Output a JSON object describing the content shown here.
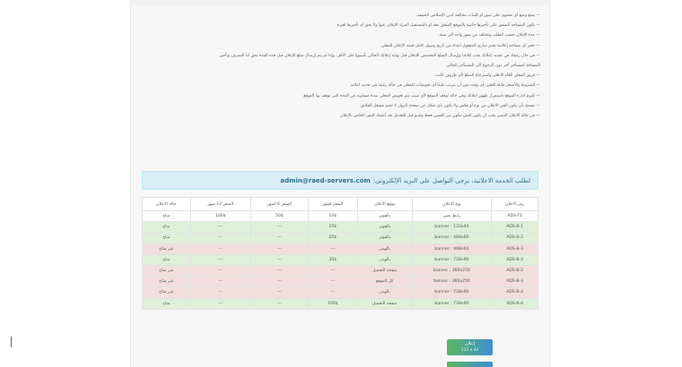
{
  "terms": [
    "— يمنع وضع اي محتوى على صور او كلمات مخالفة لدين الإسلامي الحنيف.",
    "— تكون المساحة المتفق على تأجيرها خاصة بالموقع المتفق معه او بالمستقبل المراد الإعلان عنها ولا يحق له تأجيرها لغيره.",
    "— مدة الإعلان حسب الطلب وتختلف من شهر واحد الى سنة.",
    "— حجز اي مساحة إعلانية يعتبر ساري المفعول ابتداء من تاريخ وصول كامل قيمة الإعلان للمعلن.",
    "— في حال رغبتك في تجديد إعلانك يجب ابلاغنا وإرسال المبلغ المخصص للإعلان قبل نهاية إعلانك الحالي بأسبوع على الأقل، وإذا لم يتم إرسال مبلغ الإعلان قبل هذه المدة يحق لنا التصرف وتأجير",
    "المساحة لمستأجر آخر دون الرجوع الى المستأجر الحالي.",
    "— فريق المعلن الغاء الاعلان واسترجاع المبلغ لأي ظروف كانت.",
    "— الشروط والأسعار قابلة للتغير بأي وقت دون أن يترتب علينا أي تعويضات للمعلن في حالة رغبته في تجديد اعلانه.",
    "— تلتزم ادارة الموقع باستمرار ظهور اعلانك وفي حالة توقف الموقع لأي سبب يتم تعويض المعلن بمدة مساوية عن المدة التي توقف بها الموقع",
    "— نسمح بأن يكون الفي الاعلان من نوع أو فلاش ولا يكون باي شكل عن صفحة الزوار لا تحتم مشغل الفلاش",
    "— في حالة الاعلان النصي يجب ان يكون النص مكون من كلمتين فقط ولديو قبل للتعديل بعد اعتماد النص الخاص بالإعلان"
  ],
  "contact": {
    "text": "لطلب الخدمة الاعلانية، يرجى التواصل على البريد الإلكتروني:",
    "email": "admin@raed-servers.com"
  },
  "table": {
    "headers": [
      "رمز الاعلان",
      "نوع الاعلان",
      "موقع الاعلان",
      "السعر لشهر",
      "السعر 6 أشهر",
      "السعر 12 شهر",
      "حالة الاعلان"
    ],
    "rows": [
      {
        "status": "white",
        "cells": [
          "ADS-T1",
          "رابط نصي",
          "بالفوتر",
          "10$",
          "50$",
          "100$",
          "متاح"
        ]
      },
      {
        "status": "green",
        "cells": [
          "ADS-B-1",
          "banner : 133x44",
          "بالفوتر",
          "15$",
          "---",
          "---",
          "متاح"
        ]
      },
      {
        "status": "green",
        "cells": [
          "ADS-B-2",
          "banner : 468x60",
          "بالفوتر",
          "25$",
          "---",
          "---",
          "متاح"
        ]
      },
      {
        "status": "red",
        "cells": [
          "ADS-B-3",
          "banner : 468x60",
          "بالهيدر",
          "---",
          "---",
          "---",
          "غير متاح"
        ]
      },
      {
        "status": "green",
        "cells": [
          "ADS-B-4",
          "banner : 728x90",
          "بالهيدر",
          "35$",
          "---",
          "---",
          "متاح"
        ]
      },
      {
        "status": "red",
        "cells": [
          "ADS-B-2",
          "banner : 360x250",
          "صفحة التحميل",
          "---",
          "---",
          "---",
          "غير متاح"
        ]
      },
      {
        "status": "red",
        "cells": [
          "ADS-B-3",
          "banner : 360x250",
          "كل الموقع",
          "---",
          "---",
          "---",
          "غير متاح"
        ]
      },
      {
        "status": "red",
        "cells": [
          "ADS-B-4",
          "banner : 728x90",
          "بالهيدر",
          "---",
          "---",
          "---",
          "غير متاح"
        ]
      },
      {
        "status": "green",
        "cells": [
          "ADS-B-4",
          "banner : 728x90",
          "صفحة التحميل",
          "100$",
          "---",
          "---",
          "متاح"
        ]
      }
    ]
  },
  "ad_button": {
    "label": "إعلان",
    "size": "133 x 44"
  },
  "colors": {
    "green_row": "#dff0d8",
    "red_row": "#f2dede",
    "contact_bg": "#d9edf7",
    "contact_text": "#31708f"
  }
}
